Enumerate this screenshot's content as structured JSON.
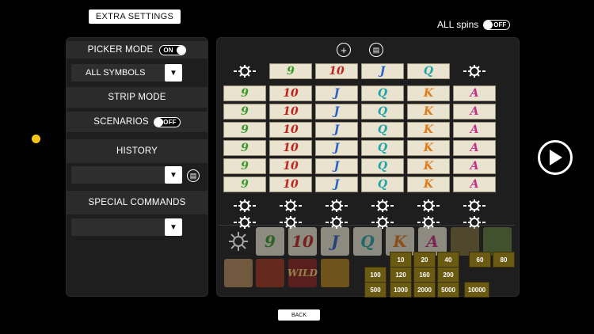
{
  "header": {
    "title": "EXTRA SETTINGS"
  },
  "all_spins": {
    "label": "ALL spins",
    "toggle": "OFF"
  },
  "left_panel": {
    "picker_mode": {
      "label": "PICKER MODE",
      "toggle": "ON"
    },
    "symbols_dropdown": {
      "value": "ALL SYMBOLS"
    },
    "strip_mode": {
      "label": "STRIP MODE"
    },
    "scenarios": {
      "label": "SCENARIOS",
      "toggle": "OFF"
    },
    "history": {
      "label": "HISTORY",
      "value": ""
    },
    "special_commands": {
      "label": "SPECIAL COMMANDS",
      "value": ""
    }
  },
  "reel_header": [
    "9",
    "10",
    "J",
    "Q"
  ],
  "reels": [
    [
      "9",
      "10",
      "J",
      "Q",
      "K",
      "A"
    ],
    [
      "9",
      "10",
      "J",
      "Q",
      "K",
      "A"
    ],
    [
      "9",
      "10",
      "J",
      "Q",
      "K",
      "A"
    ],
    [
      "9",
      "10",
      "J",
      "Q",
      "K",
      "A"
    ],
    [
      "9",
      "10",
      "J",
      "Q",
      "K",
      "A"
    ],
    [
      "9",
      "10",
      "J",
      "Q",
      "K",
      "A"
    ]
  ],
  "palette_symbols": [
    "9",
    "10",
    "J",
    "Q",
    "K",
    "A"
  ],
  "palette_specials": [
    "WILD"
  ],
  "multipliers": [
    "10",
    "20",
    "40",
    "60",
    "80",
    "100",
    "120",
    "160",
    "200",
    "500",
    "1000",
    "2000",
    "5000",
    "10000"
  ],
  "footer": {
    "back": "BACK"
  },
  "colors": {
    "9": "#3a9a2e",
    "10": "#c0241e",
    "J": "#2a62c4",
    "Q": "#1fa3a8",
    "K": "#e07a1a",
    "A": "#c42f8a"
  }
}
